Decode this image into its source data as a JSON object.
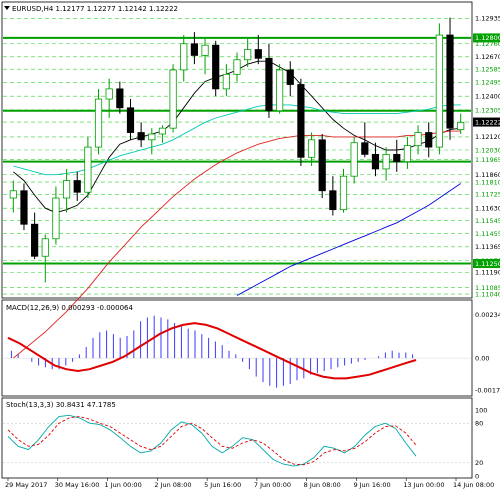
{
  "chart_data": [
    {
      "type": "candlestick",
      "title": "EURUSD,H4  1.12177 1.12277 1.12142 1.12222",
      "ylim": [
        1.1102,
        1.1304
      ],
      "y_ticks": [
        "1.12935",
        "1.12800",
        "1.12760",
        "1.12670",
        "1.12585",
        "1.12495",
        "1.12400",
        "1.12305",
        "1.12222",
        "1.12120",
        "1.12030",
        "1.11965",
        "1.11860",
        "1.11810",
        "1.11725",
        "1.11630",
        "1.11545",
        "1.11455",
        "1.11365",
        "1.11270",
        "1.11250",
        "1.11190",
        "1.11085",
        "1.11040"
      ],
      "current_price": 1.12222,
      "support_resistance": [
        1.128,
        1.123,
        1.1195,
        1.1125
      ],
      "candles": [
        {
          "t": "29 May 2017",
          "o": 1.117,
          "h": 1.1182,
          "l": 1.116,
          "c": 1.1175
        },
        {
          "t": "",
          "o": 1.1175,
          "h": 1.118,
          "l": 1.1148,
          "c": 1.1152
        },
        {
          "t": "",
          "o": 1.1152,
          "h": 1.116,
          "l": 1.1128,
          "c": 1.113
        },
        {
          "t": "",
          "o": 1.113,
          "h": 1.1145,
          "l": 1.1112,
          "c": 1.1142
        },
        {
          "t": "",
          "o": 1.1142,
          "h": 1.1178,
          "l": 1.1138,
          "c": 1.117
        },
        {
          "t": "",
          "o": 1.117,
          "h": 1.119,
          "l": 1.116,
          "c": 1.1182
        },
        {
          "t": "30 May 16:00",
          "o": 1.1182,
          "h": 1.1188,
          "l": 1.1168,
          "c": 1.1174
        },
        {
          "t": "",
          "o": 1.1174,
          "h": 1.1212,
          "l": 1.117,
          "c": 1.1205
        },
        {
          "t": "",
          "o": 1.1205,
          "h": 1.1245,
          "l": 1.12,
          "c": 1.1238
        },
        {
          "t": "",
          "o": 1.1238,
          "h": 1.1252,
          "l": 1.1225,
          "c": 1.1245
        },
        {
          "t": "",
          "o": 1.1245,
          "h": 1.125,
          "l": 1.1228,
          "c": 1.1232
        },
        {
          "t": "1 Jun 00:00",
          "o": 1.1232,
          "h": 1.1238,
          "l": 1.121,
          "c": 1.1215
        },
        {
          "t": "",
          "o": 1.1215,
          "h": 1.1222,
          "l": 1.1205,
          "c": 1.121
        },
        {
          "t": "",
          "o": 1.121,
          "h": 1.1218,
          "l": 1.12,
          "c": 1.1214
        },
        {
          "t": "",
          "o": 1.1214,
          "h": 1.122,
          "l": 1.1208,
          "c": 1.1218
        },
        {
          "t": "2 Jun 08:00",
          "o": 1.1218,
          "h": 1.1262,
          "l": 1.1215,
          "c": 1.1258
        },
        {
          "t": "",
          "o": 1.1258,
          "h": 1.1282,
          "l": 1.125,
          "c": 1.1276
        },
        {
          "t": "",
          "o": 1.1276,
          "h": 1.1284,
          "l": 1.1262,
          "c": 1.1268
        },
        {
          "t": "",
          "o": 1.1268,
          "h": 1.128,
          "l": 1.1255,
          "c": 1.1275
        },
        {
          "t": "",
          "o": 1.1275,
          "h": 1.1278,
          "l": 1.124,
          "c": 1.1245
        },
        {
          "t": "5 Jun 16:00",
          "o": 1.1245,
          "h": 1.1262,
          "l": 1.124,
          "c": 1.1255
        },
        {
          "t": "",
          "o": 1.1255,
          "h": 1.127,
          "l": 1.125,
          "c": 1.1265
        },
        {
          "t": "",
          "o": 1.1265,
          "h": 1.128,
          "l": 1.126,
          "c": 1.1272
        },
        {
          "t": "",
          "o": 1.1272,
          "h": 1.1282,
          "l": 1.1262,
          "c": 1.1266
        },
        {
          "t": "7 Jun 00:00",
          "o": 1.1266,
          "h": 1.1276,
          "l": 1.1225,
          "c": 1.123
        },
        {
          "t": "",
          "o": 1.123,
          "h": 1.1262,
          "l": 1.1228,
          "c": 1.1258
        },
        {
          "t": "",
          "o": 1.1258,
          "h": 1.1264,
          "l": 1.124,
          "c": 1.1248
        },
        {
          "t": "",
          "o": 1.1248,
          "h": 1.1252,
          "l": 1.1192,
          "c": 1.1198
        },
        {
          "t": "8 Jun 08:00",
          "o": 1.1198,
          "h": 1.1215,
          "l": 1.1192,
          "c": 1.121
        },
        {
          "t": "",
          "o": 1.121,
          "h": 1.1214,
          "l": 1.117,
          "c": 1.1175
        },
        {
          "t": "",
          "o": 1.1175,
          "h": 1.1185,
          "l": 1.1158,
          "c": 1.1162
        },
        {
          "t": "",
          "o": 1.1162,
          "h": 1.119,
          "l": 1.116,
          "c": 1.1185
        },
        {
          "t": "9 Jun 16:00",
          "o": 1.1185,
          "h": 1.1212,
          "l": 1.118,
          "c": 1.1208
        },
        {
          "t": "",
          "o": 1.1208,
          "h": 1.1222,
          "l": 1.1198,
          "c": 1.12
        },
        {
          "t": "",
          "o": 1.12,
          "h": 1.1208,
          "l": 1.1185,
          "c": 1.119
        },
        {
          "t": "",
          "o": 1.119,
          "h": 1.1205,
          "l": 1.1182,
          "c": 1.12
        },
        {
          "t": "13 Jun 00:00",
          "o": 1.12,
          "h": 1.121,
          "l": 1.1188,
          "c": 1.1195
        },
        {
          "t": "",
          "o": 1.1195,
          "h": 1.1212,
          "l": 1.119,
          "c": 1.1206
        },
        {
          "t": "",
          "o": 1.1206,
          "h": 1.122,
          "l": 1.12,
          "c": 1.1215
        },
        {
          "t": "",
          "o": 1.1215,
          "h": 1.1222,
          "l": 1.1198,
          "c": 1.1205
        },
        {
          "t": "14 Jun 08:00",
          "o": 1.1205,
          "h": 1.129,
          "l": 1.12,
          "c": 1.1282
        },
        {
          "t": "",
          "o": 1.1282,
          "h": 1.1294,
          "l": 1.121,
          "c": 1.1218
        },
        {
          "t": "",
          "o": 1.1217,
          "h": 1.1228,
          "l": 1.1214,
          "c": 1.1222
        }
      ],
      "moving_averages": [
        {
          "color": "#000000",
          "values": [
            1.1188,
            1.1182,
            1.1172,
            1.1163,
            1.116,
            1.1162,
            1.1165,
            1.1172,
            1.1185,
            1.1198,
            1.1207,
            1.121,
            1.1212,
            1.1214,
            1.1216,
            1.1222,
            1.1232,
            1.1242,
            1.125,
            1.1253,
            1.1255,
            1.1258,
            1.1262,
            1.1264,
            1.1264,
            1.126,
            1.1256,
            1.1248,
            1.124,
            1.1232,
            1.1224,
            1.1218,
            1.1213,
            1.121,
            1.1206,
            1.1203,
            1.1203,
            1.1204,
            1.1207,
            1.1209,
            1.1214,
            1.1217,
            1.1218
          ]
        },
        {
          "color": "#00c8b4",
          "values": [
            1.1192,
            1.119,
            1.1188,
            1.1186,
            1.1186,
            1.1187,
            1.1188,
            1.119,
            1.1193,
            1.1196,
            1.1199,
            1.1201,
            1.1203,
            1.1205,
            1.1207,
            1.121,
            1.1214,
            1.1218,
            1.1222,
            1.1225,
            1.1227,
            1.1229,
            1.1231,
            1.1233,
            1.1234,
            1.1234,
            1.1234,
            1.1233,
            1.1232,
            1.123,
            1.1229,
            1.1228,
            1.1228,
            1.1228,
            1.1228,
            1.1228,
            1.1228,
            1.1229,
            1.123,
            1.1231,
            1.1233,
            1.1234,
            1.1234
          ]
        },
        {
          "color": "#e02020",
          "values": [
            1.106,
            1.1066,
            1.1072,
            1.1078,
            1.1085,
            1.1092,
            1.11,
            1.1108,
            1.1117,
            1.1126,
            1.1134,
            1.1142,
            1.115,
            1.1157,
            1.1164,
            1.1171,
            1.1177,
            1.1183,
            1.1188,
            1.1193,
            1.1197,
            1.1201,
            1.1204,
            1.1207,
            1.1209,
            1.1211,
            1.1212,
            1.1213,
            1.1213,
            1.1213,
            1.1212,
            1.1212,
            1.1212,
            1.1212,
            1.1212,
            1.1212,
            1.1212,
            1.1213,
            1.1213,
            1.1214,
            1.1215,
            1.1216,
            1.1216
          ]
        },
        {
          "color": "#0000e0",
          "values": [
            null,
            null,
            null,
            null,
            null,
            null,
            null,
            null,
            null,
            null,
            null,
            null,
            null,
            null,
            null,
            null,
            null,
            null,
            null,
            null,
            null,
            1.1103,
            1.1107,
            1.1111,
            1.1115,
            1.1119,
            1.1123,
            1.1126,
            1.1129,
            1.1132,
            1.1135,
            1.1138,
            1.1141,
            1.1144,
            1.1147,
            1.115,
            1.1153,
            1.1157,
            1.1161,
            1.1165,
            1.117,
            1.1175,
            1.118
          ]
        }
      ]
    },
    {
      "type": "bar",
      "title": "MACD(12,26,9) 0.000293 -0.000064",
      "ylim": [
        -0.002,
        0.0025
      ],
      "y_ticks": [
        "0.002344",
        "0.00",
        "-0.001741"
      ],
      "histogram": [
        0.0004,
        0.0002,
        0.0,
        -0.0002,
        -0.0004,
        -0.0005,
        -0.0006,
        -0.0006,
        -0.0004,
        -0.0002,
        0.0002,
        0.0006,
        0.0011,
        0.0014,
        0.0015,
        0.0013,
        0.0011,
        0.0012,
        0.0015,
        0.002,
        0.0022,
        0.0023,
        0.0022,
        0.0021,
        0.0019,
        0.0018,
        0.0016,
        0.0015,
        0.0013,
        0.0011,
        0.0009,
        0.0007,
        0.0004,
        0.0002,
        -0.0002,
        -0.0006,
        -0.001,
        -0.0013,
        -0.0015,
        -0.0016,
        -0.0015,
        -0.0014,
        -0.0012,
        -0.0011,
        -0.0009,
        -0.0008,
        -0.0007,
        -0.0006,
        -0.0005,
        -0.0004,
        -0.0003,
        -0.0002,
        -0.0001,
        0.0,
        0.0001,
        0.0003,
        0.0004,
        0.0003,
        0.0003,
        0.0002
      ],
      "signal": [
        0.0011,
        0.0008,
        0.0004,
        0.0,
        -0.0004,
        -0.0006,
        -0.0007,
        -0.0006,
        -0.0004,
        -0.0002,
        0.0001,
        0.0005,
        0.0009,
        0.0013,
        0.0016,
        0.0018,
        0.0019,
        0.0018,
        0.0016,
        0.0013,
        0.001,
        0.0007,
        0.0004,
        0.0001,
        -0.0002,
        -0.0005,
        -0.0008,
        -0.001,
        -0.0011,
        -0.0011,
        -0.001,
        -0.0009,
        -0.0007,
        -0.0005,
        -0.0003,
        -0.0001
      ],
      "signal_color": "#e00000",
      "histogram_color": "#3a3aff"
    },
    {
      "type": "line",
      "title": "Stoch(13,3,3) 30.8431 47.1785",
      "ylim": [
        0,
        100
      ],
      "y_ticks": [
        "100",
        "80",
        "20",
        "0"
      ],
      "series": [
        {
          "color": "#00a8a8",
          "values": [
            60,
            45,
            40,
            55,
            75,
            90,
            92,
            88,
            80,
            78,
            70,
            58,
            45,
            35,
            38,
            50,
            70,
            82,
            78,
            65,
            45,
            35,
            45,
            58,
            55,
            40,
            25,
            18,
            15,
            18,
            28,
            45,
            42,
            35,
            45,
            62,
            75,
            80,
            72,
            50,
            30
          ]
        },
        {
          "color": "#e00000",
          "values": [
            70,
            55,
            45,
            48,
            62,
            80,
            88,
            90,
            86,
            80,
            75,
            65,
            55,
            45,
            40,
            45,
            60,
            75,
            80,
            72,
            58,
            45,
            42,
            50,
            55,
            50,
            38,
            25,
            18,
            17,
            22,
            35,
            40,
            38,
            42,
            52,
            65,
            75,
            76,
            65,
            47
          ]
        }
      ]
    }
  ],
  "x_labels": [
    "29 May 2017",
    "30 May 16:00",
    "1 Jun 00:00",
    "2 Jun 08:00",
    "5 Jun 16:00",
    "7 Jun 00:00",
    "8 Jun 08:00",
    "9 Jun 16:00",
    "13 Jun 00:00",
    "14 Jun 08:00"
  ],
  "colors": {
    "up": "#00a000",
    "down": "#000000",
    "level": "#00a000",
    "dash": "#00c800",
    "axis": "#000000",
    "price_box": "#000000"
  }
}
